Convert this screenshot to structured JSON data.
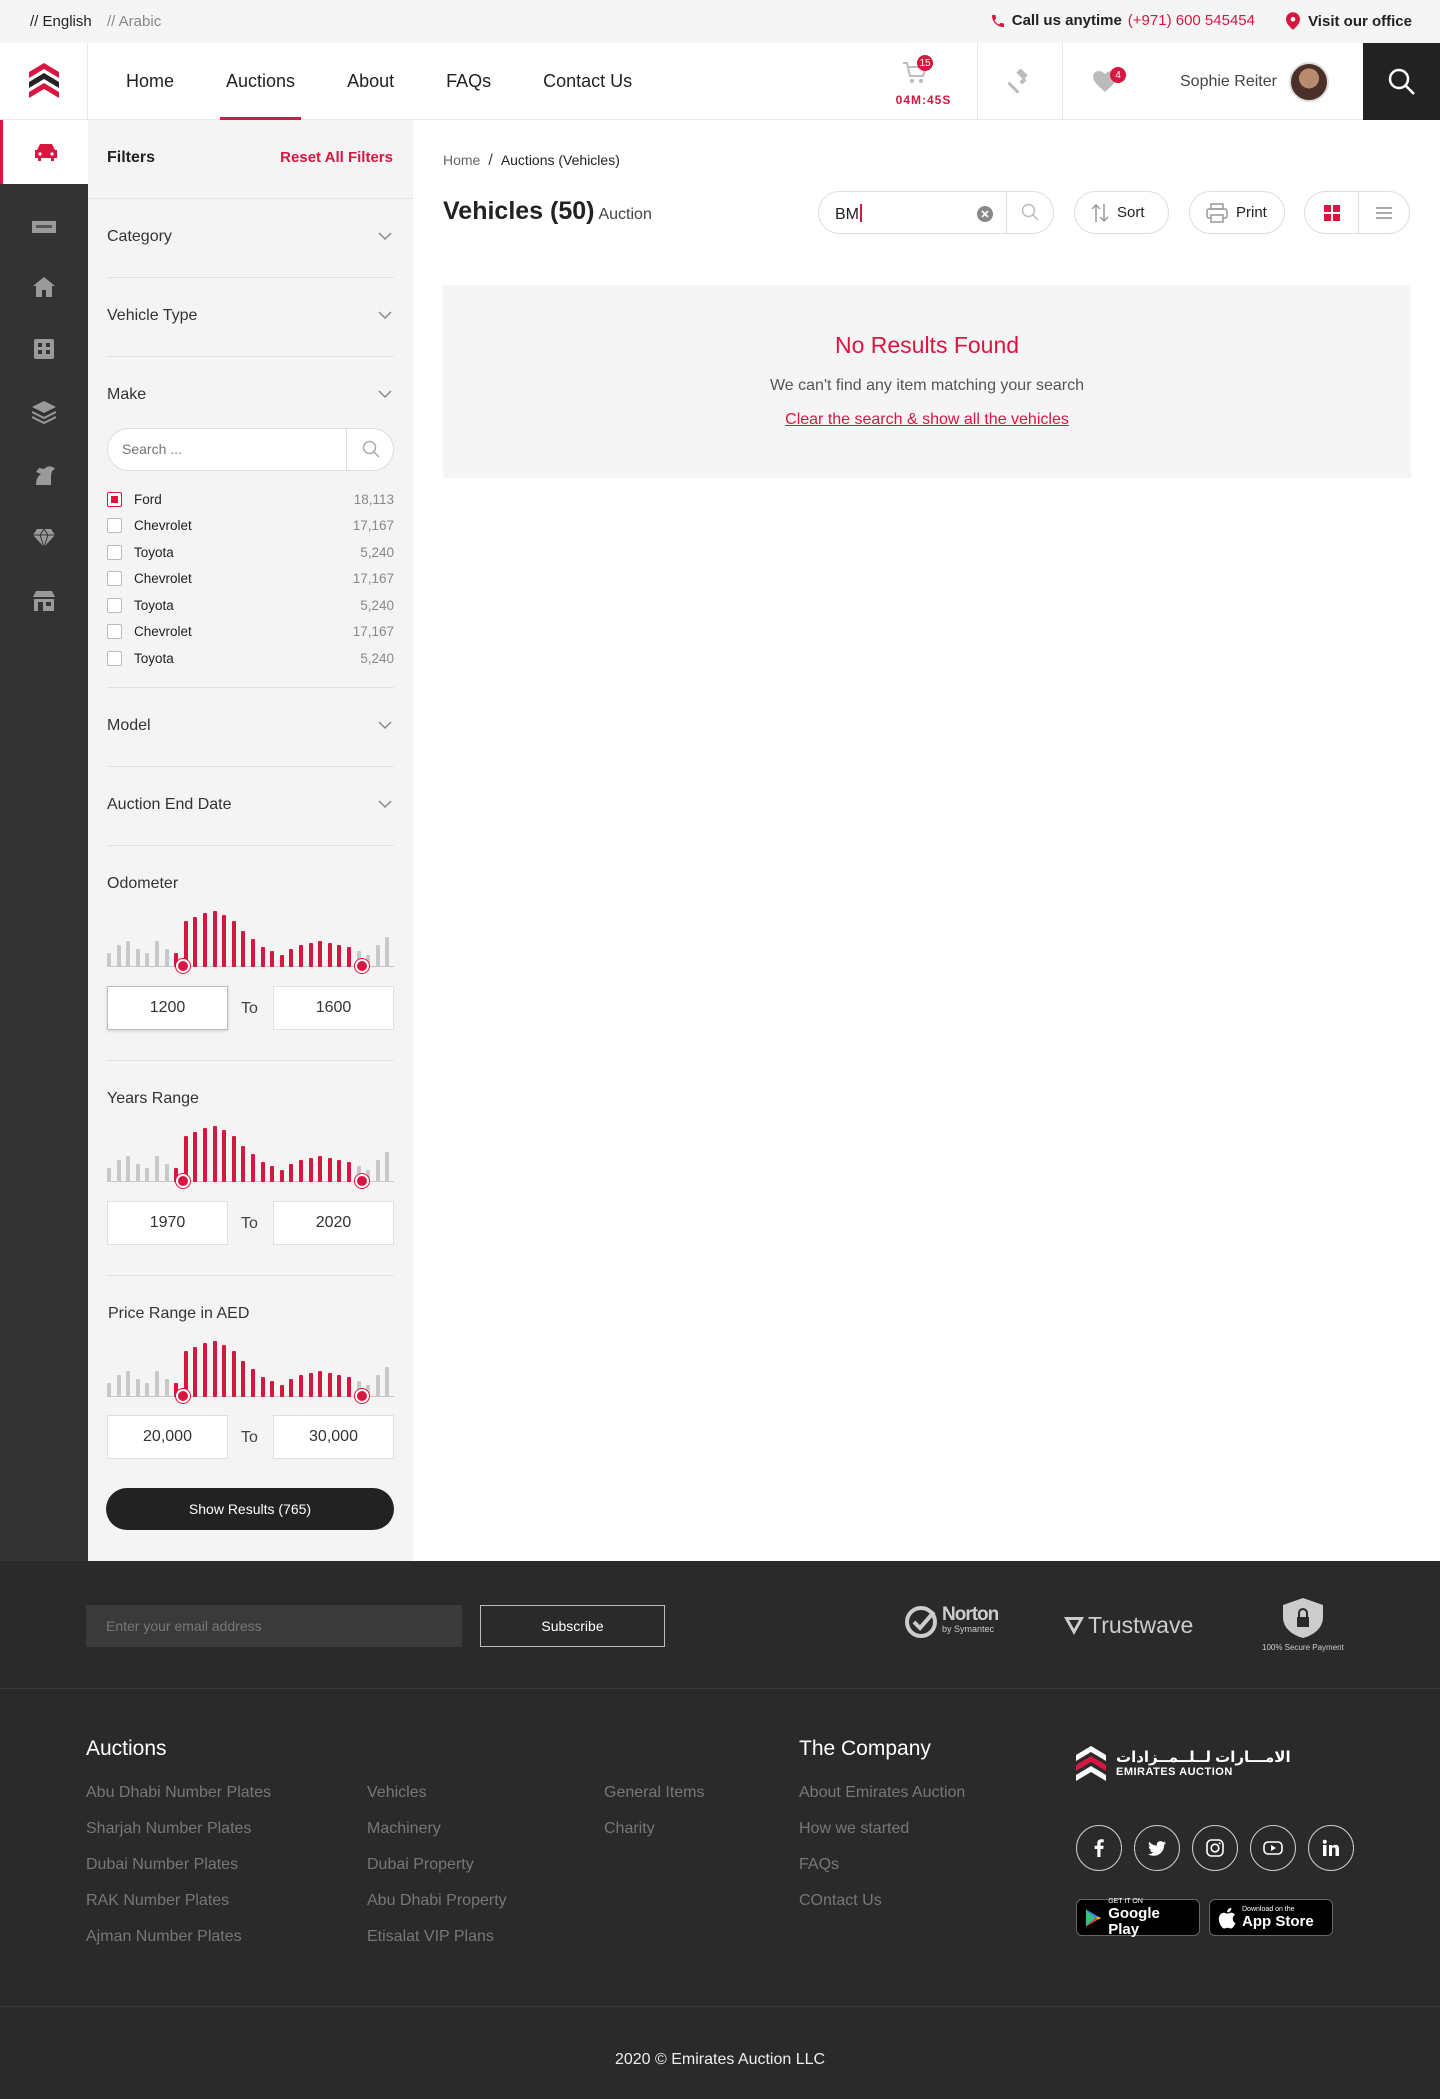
{
  "topbar": {
    "lang_en": "// English",
    "lang_ar": "// Arabic",
    "call_label": "Call us anytime",
    "call_number": "(+971) 600 545454",
    "visit_label": "Visit our office"
  },
  "header": {
    "nav": [
      {
        "label": "Home",
        "active": false
      },
      {
        "label": "Auctions",
        "active": true
      },
      {
        "label": "About",
        "active": false
      },
      {
        "label": "FAQs",
        "active": false
      },
      {
        "label": "Contact Us",
        "active": false
      }
    ],
    "cart_count": "15",
    "cart_timer": "04M:45S",
    "wishlist_count": "4",
    "user_name": "Sophie Reiter"
  },
  "filters": {
    "title": "Filters",
    "reset": "Reset All Filters",
    "category": "Category",
    "vehicle_type": "Vehicle Type",
    "make": "Make",
    "make_search_placeholder": "Search ...",
    "makes": [
      {
        "name": "Ford",
        "count": "18,113",
        "checked": true
      },
      {
        "name": "Chevrolet",
        "count": "17,167",
        "checked": false
      },
      {
        "name": "Toyota",
        "count": "5,240",
        "checked": false
      },
      {
        "name": "Chevrolet",
        "count": "17,167",
        "checked": false
      },
      {
        "name": "Toyota",
        "count": "5,240",
        "checked": false
      },
      {
        "name": "Chevrolet",
        "count": "17,167",
        "checked": false
      },
      {
        "name": "Toyota",
        "count": "5,240",
        "checked": false
      }
    ],
    "model": "Model",
    "auction_end_date": "Auction End Date",
    "odometer": {
      "title": "Odometer",
      "from": "1200",
      "to": "1600",
      "to_label": "To"
    },
    "years": {
      "title": "Years Range",
      "from": "1970",
      "to": "2020",
      "to_label": "To"
    },
    "price": {
      "title": "Price Range in AED",
      "from": "20,000",
      "to": "30,000",
      "to_label": "To"
    },
    "show_results": "Show Results (765)"
  },
  "main": {
    "breadcrumb_home": "Home",
    "breadcrumb_current": "Auctions (Vehicles)",
    "title": "Vehicles (50)",
    "subtitle": "Auction",
    "search_value": "BM",
    "sort_label": "Sort",
    "print_label": "Print",
    "no_results_title": "No Results Found",
    "no_results_text": "We can't find any item matching your search",
    "no_results_link": "Clear the search & show all the vehicles"
  },
  "footer": {
    "email_placeholder": "Enter your email address",
    "subscribe": "Subscribe",
    "norton": "Norton",
    "norton_sub": "by Symantec",
    "trustwave": "Trustwave",
    "secure": "100% Secure Payment",
    "auctions_title": "Auctions",
    "col1": [
      "Abu Dhabi Number Plates",
      "Sharjah Number Plates",
      "Dubai Number Plates",
      "RAK Number Plates",
      "Ajman Number Plates"
    ],
    "col2": [
      "Vehicles",
      "Machinery",
      "Dubai Property",
      "Abu Dhabi Property",
      "Etisalat VIP Plans"
    ],
    "col3": [
      "General Items",
      "Charity"
    ],
    "company_title": "The Company",
    "col4": [
      "About Emirates Auction",
      "How we started",
      "FAQs",
      "COntact Us"
    ],
    "brand_ar": "الامـــارات لــلــمــزادات",
    "brand_en": "EMIRATES AUCTION",
    "google_small": "GET IT ON",
    "google_big": "Google Play",
    "apple_small": "Download on the",
    "apple_big": "App Store",
    "copyright": "2020 © Emirates Auction LLC"
  },
  "colors": {
    "accent": "#d7173f",
    "dark": "#2a2a2a",
    "rail": "#333333"
  }
}
